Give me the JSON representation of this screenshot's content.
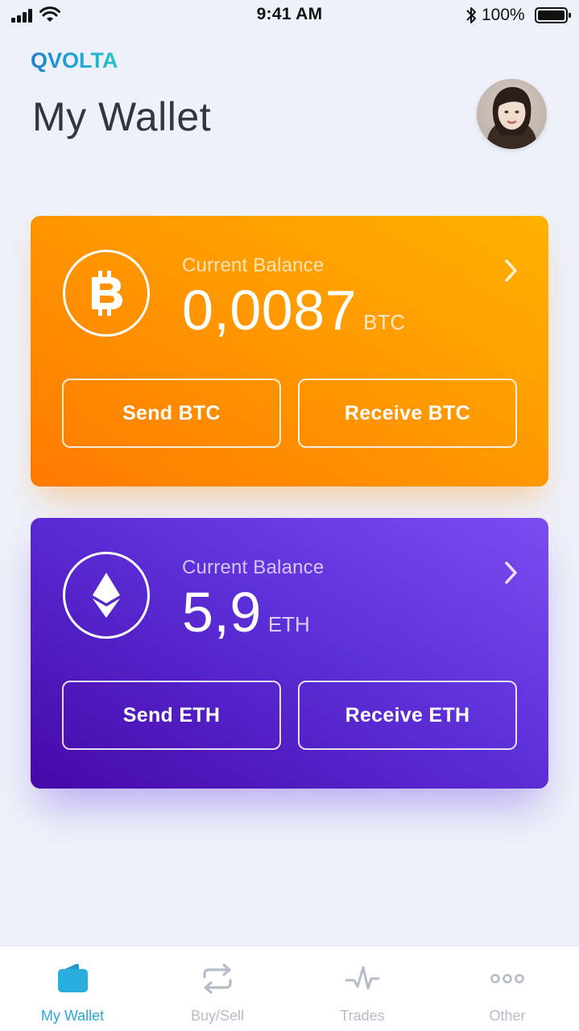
{
  "status_bar": {
    "time": "9:41 AM",
    "battery_percent": "100%",
    "signal_icon": "cellular-signal-icon",
    "wifi_icon": "wifi-icon",
    "bluetooth_icon": "bluetooth-icon",
    "battery_icon": "battery-icon",
    "battery_level": 1.0
  },
  "header": {
    "logo_text": "QVOLTA",
    "title": "My Wallet",
    "avatar_icon": "user-avatar"
  },
  "wallets": [
    {
      "coin_icon": "bitcoin-icon",
      "balance_label": "Current Balance",
      "balance_value": "0,0087",
      "balance_unit": "BTC",
      "send_label": "Send BTC",
      "receive_label": "Receive BTC",
      "chevron_icon": "chevron-right-icon",
      "accent": "#ff9500"
    },
    {
      "coin_icon": "ethereum-icon",
      "balance_label": "Current Balance",
      "balance_value": "5,9",
      "balance_unit": "ETH",
      "send_label": "Send ETH",
      "receive_label": "Receive ETH",
      "chevron_icon": "chevron-right-icon",
      "accent": "#5b2fd6"
    }
  ],
  "tab_bar": {
    "active_color": "#2aa9d8",
    "inactive_color": "#b7bcc8",
    "tabs": [
      {
        "label": "My Wallet",
        "icon": "wallet-icon",
        "active": true
      },
      {
        "label": "Buy/Sell",
        "icon": "swap-arrows-icon",
        "active": false
      },
      {
        "label": "Trades",
        "icon": "pulse-chart-icon",
        "active": false
      },
      {
        "label": "Other",
        "icon": "more-dots-icon",
        "active": false
      }
    ]
  }
}
